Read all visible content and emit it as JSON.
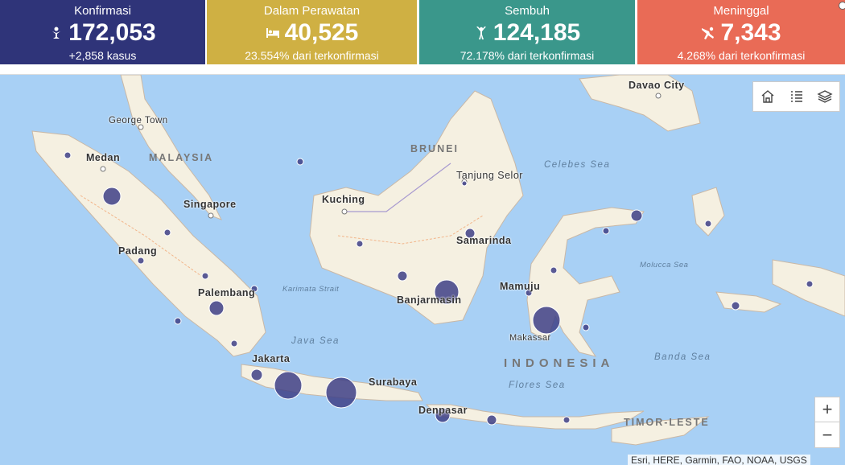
{
  "stats": {
    "confirmed": {
      "label": "Konfirmasi",
      "value": "172,053",
      "sub": "+2,858 kasus",
      "color": "#2f3479",
      "icon": "person-icon"
    },
    "treated": {
      "label": "Dalam Perawatan",
      "value": "40,525",
      "sub": "23.554% dari terkonfirmasi",
      "color": "#cfb043",
      "icon": "bed-icon"
    },
    "recovered": {
      "label": "Sembuh",
      "value": "124,185",
      "sub": "72.178% dari terkonfirmasi",
      "color": "#3a978b",
      "icon": "cheer-icon"
    },
    "died": {
      "label": "Meninggal",
      "value": "7,343",
      "sub": "4.268% dari terkonfirmasi",
      "color": "#e96b56",
      "icon": "falling-person-icon"
    }
  },
  "map": {
    "places": {
      "davao": "Davao City",
      "george_town": "George Town",
      "medan": "Medan",
      "singapore": "Singapore",
      "kuching": "Kuching",
      "tanjung_selor": "Tanjung Selor",
      "samarinda": "Samarinda",
      "padang": "Padang",
      "palembang": "Palembang",
      "banjarmasin": "Banjarmasin",
      "mamuju": "Mamuju",
      "makassar": "Makassar",
      "jakarta": "Jakarta",
      "surabaya": "Surabaya",
      "denpasar": "Denpasar"
    },
    "countries": {
      "malaysia": "MALAYSIA",
      "brunei": "BRUNEI",
      "indonesia": "INDONESIA",
      "timor": "TIMOR-LESTE"
    },
    "seas": {
      "celebes": "Celebes Sea",
      "molucca": "Molucca Sea",
      "karimata": "Karimata Strait",
      "java": "Java Sea",
      "banda": "Banda Sea",
      "flores": "Flores Sea"
    },
    "attribution": "Esri, HERE, Garmin, FAO, NOAA, USGS",
    "zoom_in": "+",
    "zoom_out": "−"
  },
  "colors": {
    "water": "#a8d0f5",
    "land": "#f5f0e1",
    "bubble": "#3e3f86"
  }
}
